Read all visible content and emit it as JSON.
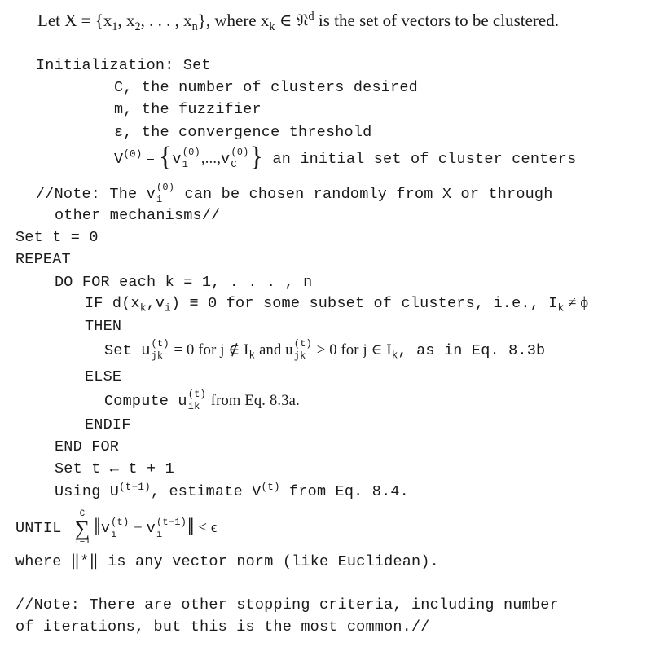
{
  "intro": {
    "prefix": "Let X = {x",
    "sub1": "1",
    "mid1": ", x",
    "sub2": "2",
    "mid2": ", . . . , x",
    "subn": "n",
    "mid3": "}, where x",
    "subk": "k",
    "elem": " ∈ 𝔑",
    "supd": "d",
    "suffix": " is the set of vectors to be clustered."
  },
  "init": {
    "heading": "Initialization: Set",
    "items": [
      "C, the number of clusters desired",
      "m, the fuzzifier",
      "ε, the convergence threshold"
    ],
    "v0": {
      "lhs": "V",
      "lhs_sup": "(0)",
      "eq": " = ",
      "open": "{",
      "v": "v",
      "first_sup": "(0)",
      "first_sub": "1",
      "dots": ",...,",
      "last_sup": "(0)",
      "last_sub": "C",
      "close": "}",
      "desc": " an initial set of cluster centers"
    }
  },
  "note1": {
    "line1_prefix": "//Note: The v",
    "line1_sup": "(0)",
    "line1_sub": "i",
    "line1_suffix": " can be chosen randomly from X or through",
    "line2": "other mechanisms//"
  },
  "set_t0": "Set t = 0",
  "repeat": "REPEAT",
  "loop": {
    "do_for": "DO FOR each k = 1, . . . , n",
    "if_prefix": "IF d(x",
    "if_sub_k": "k",
    "if_mid": ",v",
    "if_sub_i": "i",
    "if_suffix": ") ≡ 0 for some subset of clusters, i.e., I",
    "if_sub_k2": "k",
    "if_end": " ≠ ϕ",
    "then": "THEN",
    "set_u_prefix": "Set u",
    "set_u_sup": "(t)",
    "set_u_sub": "jk",
    "set_u_mid1": " = 0 for j ∉ I",
    "set_u_sub_k1": "k",
    "set_u_mid2": " and u",
    "set_u_sup2": "(t)",
    "set_u_sub2": "jk",
    "set_u_mid3": " > 0 for j ∈ I",
    "set_u_sub_k2": "k",
    "set_u_end": ", as in Eq. 8.3b",
    "else": "ELSE",
    "compute_prefix": "Compute u",
    "compute_sup": "(t)",
    "compute_sub": "ik",
    "compute_suffix": " from Eq. 8.3a.",
    "endif": "ENDIF",
    "end_for": "END FOR",
    "set_t_inc": "Set t ← t + 1",
    "using_prefix": "Using U",
    "using_sup": "(t−1)",
    "using_mid": ", estimate V",
    "using_sup2": "(t)",
    "using_suffix": " from Eq. 8.4."
  },
  "until": {
    "keyword": "UNTIL ",
    "sum_upper": "C",
    "sum_symbol": "∑",
    "sum_lower": "i=1",
    "norm_open": "‖",
    "v": "v",
    "sup1": "(t)",
    "sub1": "i",
    "minus": " − ",
    "sup2": "(t−1)",
    "sub2": "i",
    "norm_close": "‖",
    "lt": " < ϵ"
  },
  "where_line": "where ‖*‖ is any vector norm (like Euclidean).",
  "note2": {
    "line1": "//Note: There are other stopping criteria, including number",
    "line2": "of iterations, but this is the most common.//"
  }
}
